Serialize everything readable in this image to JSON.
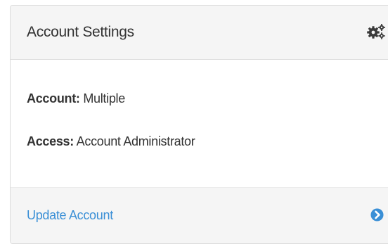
{
  "panel": {
    "title": "Account Settings",
    "header_icon": "gears-icon"
  },
  "info": {
    "account_key": "Account:",
    "account_value": "Multiple",
    "access_key": "Access:",
    "access_value": "Account Administrator"
  },
  "footer": {
    "link_label": "Update Account",
    "link_icon": "circle-arrow-right-icon"
  },
  "colors": {
    "link": "#3a8fd6",
    "text": "#333333",
    "header_bg": "#f5f5f5"
  }
}
